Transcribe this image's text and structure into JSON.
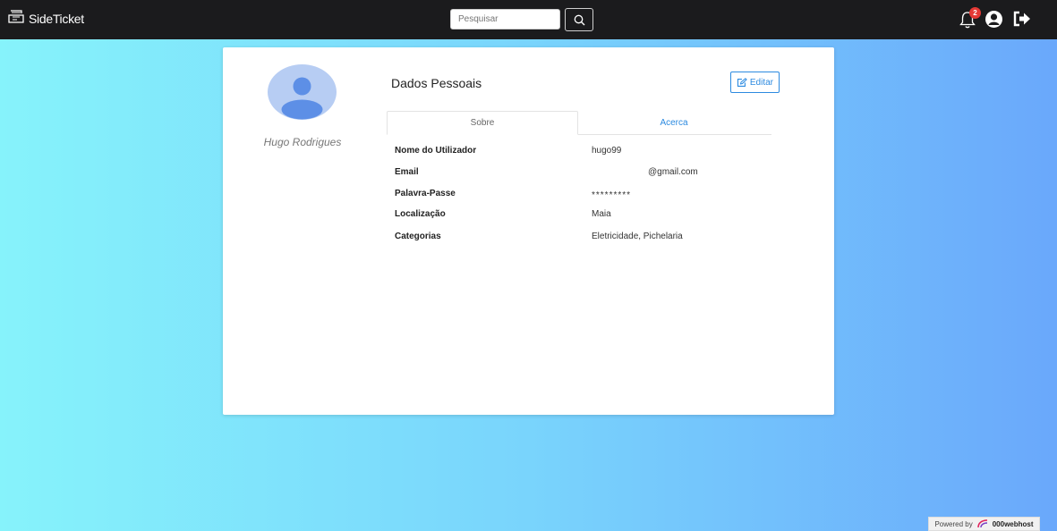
{
  "navbar": {
    "brand": "SideTicket",
    "search_placeholder": "Pesquisar",
    "notification_count": "2"
  },
  "profile": {
    "name": "Hugo Rodrigues"
  },
  "section": {
    "title": "Dados Pessoais",
    "edit_label": "Editar"
  },
  "tabs": [
    {
      "label": "Sobre"
    },
    {
      "label": "Acerca"
    }
  ],
  "details": [
    {
      "label": "Nome do Utilizador",
      "value": "hugo99"
    },
    {
      "label": "Email",
      "value": "@gmail.com"
    },
    {
      "label": "Palavra-Passe",
      "value": "*********"
    },
    {
      "label": "Localização",
      "value": "Maia"
    },
    {
      "label": "Categorias",
      "value": "Eletricidade, Pichelaria"
    }
  ],
  "footer": {
    "powered_by": "Powered by",
    "host": "000webhost"
  },
  "colors": {
    "accent": "#2c8ae0",
    "navbar": "#1b1b1d",
    "badge": "#e53935"
  }
}
